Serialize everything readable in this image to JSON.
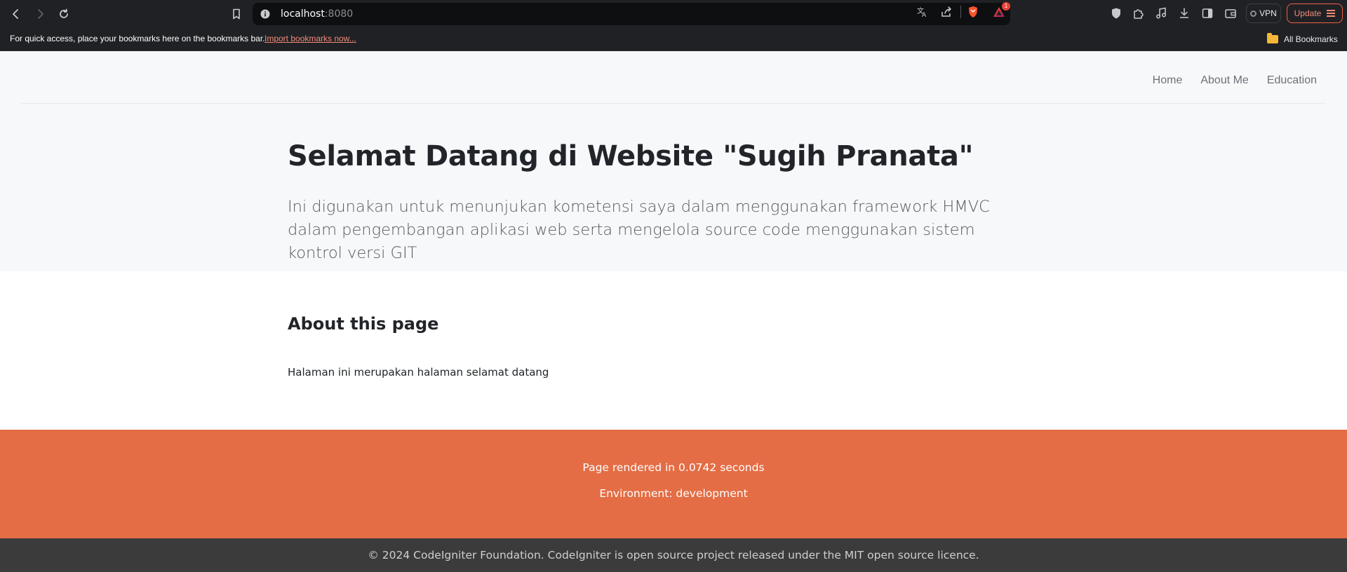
{
  "browser": {
    "url_host": "localhost",
    "url_port": ":8080",
    "vpn_label": "VPN",
    "update_label": "Update",
    "rewards_badge": "1",
    "bookmarks_message": "For quick access, place your bookmarks here on the bookmarks bar.",
    "import_bookmarks_label": "Import bookmarks now...",
    "all_bookmarks_label": "All Bookmarks",
    "accent_color": "#ee6148"
  },
  "nav": {
    "items": [
      {
        "label": "Home"
      },
      {
        "label": "About Me"
      },
      {
        "label": "Education"
      }
    ]
  },
  "hero": {
    "title": "Selamat Datang di Website \"Sugih Pranata\"",
    "lead": "Ini digunakan untuk menunjukan kometensi saya dalam menggunakan framework HMVC dalam pengembangan aplikasi web serta mengelola source code menggunakan sistem kontrol versi GIT"
  },
  "content": {
    "heading": "About this page",
    "text": "Halaman ini merupakan halaman selamat datang"
  },
  "footer": {
    "rendered": "Page rendered in 0.0742 seconds",
    "environment": "Environment: development",
    "copyright": "© 2024 CodeIgniter Foundation. CodeIgniter is open source project released under the MIT open source licence.",
    "color": "#e46d45"
  }
}
